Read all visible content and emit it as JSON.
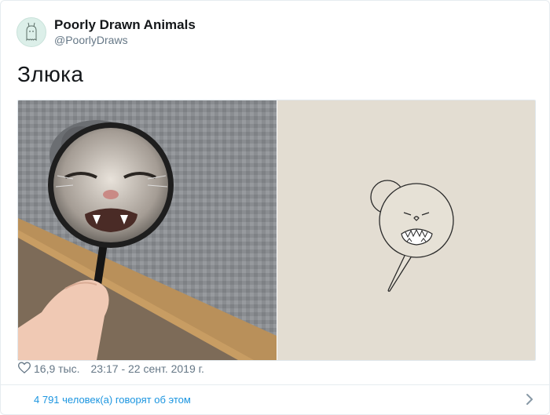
{
  "author": {
    "display_name": "Poorly Drawn Animals",
    "handle": "@PoorlyDraws"
  },
  "tweet": {
    "text": "Злюка"
  },
  "stats": {
    "likes": "16,9 тыс.",
    "timestamp": "23:17 - 22 сент. 2019 г."
  },
  "footer": {
    "conversation_label": "4 791 человек(а) говорят об этом"
  },
  "colors": {
    "link": "#1b95e0",
    "secondary_text": "#657786"
  },
  "icons": {
    "like": "heart-icon",
    "more": "chevron-right-icon"
  }
}
